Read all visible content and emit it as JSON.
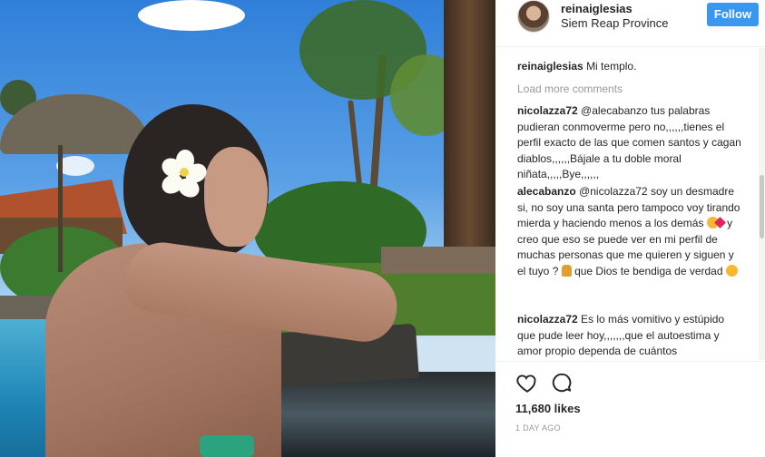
{
  "post": {
    "username": "reinaiglesias",
    "location": "Siem Reap Province",
    "follow_label": "Follow"
  },
  "caption": {
    "username": "reinaiglesias",
    "text": "Mi templo."
  },
  "load_more": "Load more comments",
  "comments": [
    {
      "username": "nicolazza72",
      "text": "@alecabanzo tus palabras pudieran conmoverme pero no,,,,,,tienes el perfil exacto de las que comen santos y cagan diablos,,,,,,Bájale a tu doble moral niñata,,,,,Bye,,,,,,"
    },
    {
      "username": "alecabanzo",
      "text_a": "@nicolazza72 soy un desmadre si, no soy una santa pero tampoco voy tirando mierda y haciendo menos a los demás",
      "text_b": "y creo que eso se puede ver en mi perfil de muchas personas que me quieren y siguen y el tuyo ?",
      "text_c": "que Dios te bendiga de verdad"
    },
    {
      "username": "nicolazza72",
      "text": "Es lo más vomitivo y estúpido que pude leer hoy,,,,,,,que el autoestima y amor propio dependa de cuántos"
    }
  ],
  "likes": "11,680 likes",
  "time": "1 DAY AGO",
  "icons": {
    "like": "heart-icon",
    "comment": "comment-icon"
  }
}
